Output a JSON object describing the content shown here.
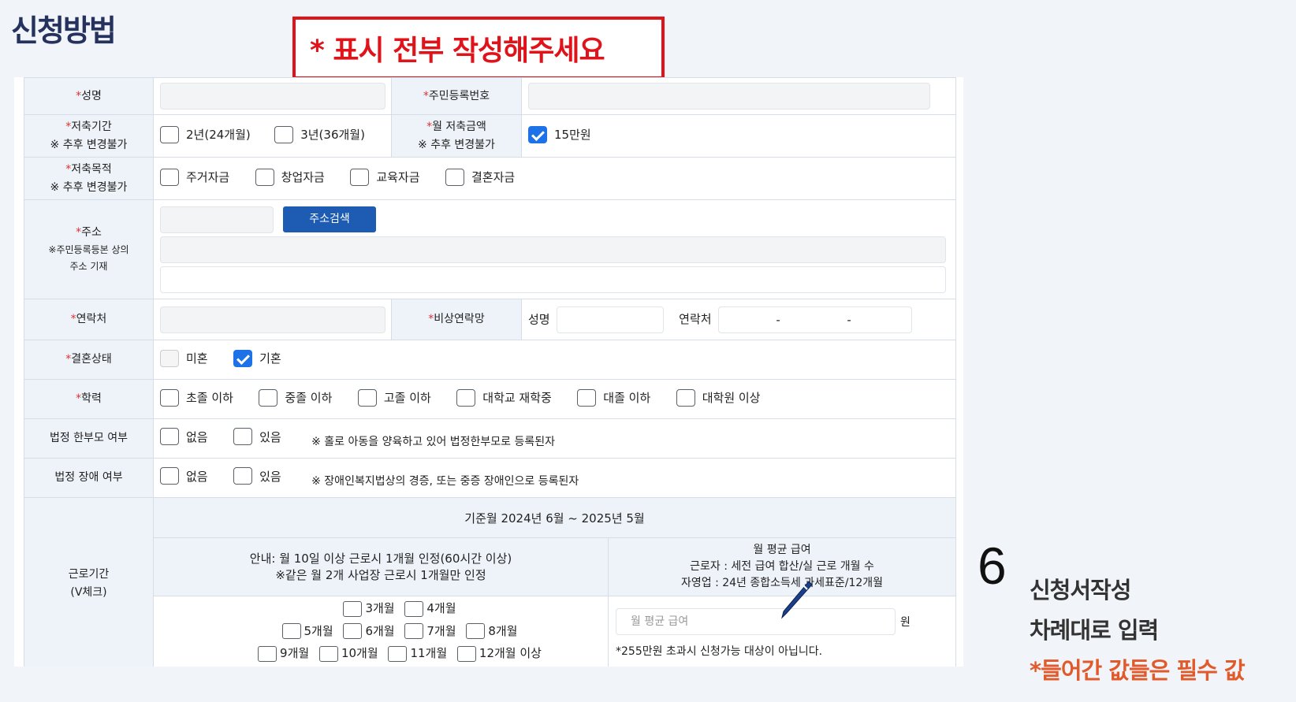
{
  "page_title": "신청방법",
  "notice": "* 표시 전부 작성해주세요",
  "form": {
    "name": {
      "label": "성명"
    },
    "rrn": {
      "label": "주민등록번호"
    },
    "period": {
      "label": "저축기간",
      "note": "※ 추후 변경불가",
      "options": [
        "2년(24개월)",
        "3년(36개월)"
      ]
    },
    "monthly": {
      "label": "월 저축금액",
      "note": "※ 추후 변경불가",
      "option": "15만원"
    },
    "purpose": {
      "label": "저축목적",
      "note": "※ 추후 변경불가",
      "options": [
        "주거자금",
        "창업자금",
        "교육자금",
        "결혼자금"
      ]
    },
    "address": {
      "label": "주소",
      "note1": "※주민등록등본 상의",
      "note2": "주소 기재",
      "search_button": "주소검색"
    },
    "contact": {
      "label": "연락처"
    },
    "emergency": {
      "label": "비상연락망",
      "name_label": "성명",
      "phone_label": "연락처",
      "dash": "-"
    },
    "marital": {
      "label": "결혼상태",
      "options": [
        "미혼",
        "기혼"
      ]
    },
    "education": {
      "label": "학력",
      "options": [
        "초졸 이하",
        "중졸 이하",
        "고졸 이하",
        "대학교 재학중",
        "대졸 이하",
        "대학원 이상"
      ]
    },
    "single_parent": {
      "label": "법정 한부모 여부",
      "options": [
        "없음",
        "있음"
      ],
      "note": "※ 홀로 아동을 양육하고 있어 법정한부모로 등록된자"
    },
    "disability": {
      "label": "법정 장애 여부",
      "options": [
        "없음",
        "있음"
      ],
      "note": "※ 장애인복지법상의 경증, 또는 중증 장애인으로 등록된자"
    },
    "work": {
      "label": "근로기간",
      "label2": "(V체크)",
      "base_month": "기준월 2024년 6월 ~ 2025년 5월",
      "guide1": "안내: 월 10일 이상 근로시 1개월 인정(60시간 이상)",
      "guide2": "※같은 월 2개 사업장 근로시 1개월만 인정",
      "salary_head1": "월 평균 급여",
      "salary_head2": "근로자 : 세전 급여 합산/실 근로 개월 수",
      "salary_head3": "자영업 : 24년 종합소득세 과세표준/12개월",
      "months_row1": [
        "3개월",
        "4개월"
      ],
      "months_row2": [
        "5개월",
        "6개월",
        "7개월",
        "8개월"
      ],
      "months_row3": [
        "9개월",
        "10개월",
        "11개월",
        "12개월 이상"
      ],
      "salary_placeholder": "월 평균 급여",
      "won": "원",
      "salary_note": "*255만원 초과시 신청가능 대상이 아닙니다."
    }
  },
  "step": {
    "number": "6",
    "title": "신청서작성",
    "desc": "차례대로 입력",
    "warning": "*들어간 값들은 필수 값"
  },
  "colors": {
    "accent_blue": "#1e5bb3",
    "notice_red": "#e0121a",
    "warning_orange": "#e05a2b"
  }
}
